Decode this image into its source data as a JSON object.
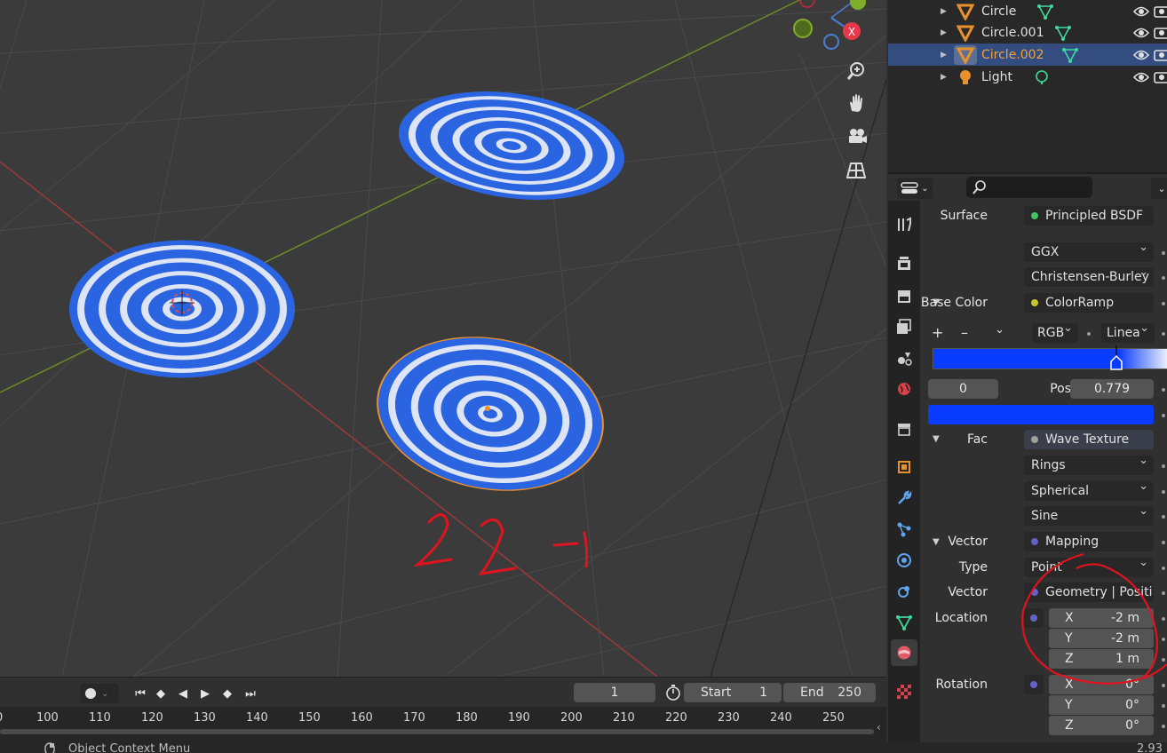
{
  "outliner": {
    "items": [
      {
        "name": "Circle",
        "type": "mesh"
      },
      {
        "name": "Circle.001",
        "type": "mesh"
      },
      {
        "name": "Circle.002",
        "type": "mesh",
        "selected": true
      },
      {
        "name": "Light",
        "type": "light"
      }
    ]
  },
  "properties": {
    "search_placeholder": "",
    "surface_label": "Surface",
    "surface_value": "Principled BSDF",
    "distribution": "GGX",
    "subsurface_method": "Christensen-Burley",
    "base_color_label": "Base Color",
    "base_color_value": "ColorRamp",
    "ramp_color_mode": "RGB",
    "ramp_interpolation": "Linea",
    "ramp_stop_index": "0",
    "pos_label": "Pos",
    "pos_value": "0.779",
    "fac_label": "Fac",
    "fac_value": "Wave Texture",
    "wave_type": "Rings",
    "wave_profile_dir": "Spherical",
    "wave_profile": "Sine",
    "vector_label": "Vector",
    "vector_value": "Mapping",
    "type_label": "Type",
    "type_value": "Point",
    "vector2_label": "Vector",
    "vector2_value": "Geometry | Positi...",
    "location_label": "Location",
    "location": {
      "x_label": "X",
      "x": "-2 m",
      "y_label": "Y",
      "y": "-2 m",
      "z_label": "Z",
      "z": "1 m"
    },
    "rotation_label": "Rotation",
    "rotation": {
      "x_label": "X",
      "x": "0°",
      "y_label": "Y",
      "y": "0°",
      "z_label": "Z",
      "z": "0°"
    }
  },
  "timeline": {
    "current_frame": "1",
    "start_label": "Start",
    "start": "1",
    "end_label": "End",
    "end": "250",
    "ruler": [
      "100",
      "110",
      "120",
      "130",
      "140",
      "150",
      "160",
      "170",
      "180",
      "190",
      "200",
      "210",
      "220",
      "230",
      "240",
      "250"
    ]
  },
  "statusbar": {
    "left": "Object Context Menu",
    "version": "2.93"
  },
  "annotation": {
    "text": "2 2 -1",
    "color": "#e0141e"
  },
  "colors": {
    "accent_selected": "#334d80",
    "ramp_blue": "#0a3cff",
    "wave_blue": "#2b64e0",
    "object_orange": "#e8902e",
    "mesh_green": "#3fd8a0"
  },
  "icons": {
    "vp_tools": [
      "zoom-icon",
      "hand-pan-icon",
      "camera-icon",
      "grid-view-icon"
    ],
    "prop_tabs": [
      "tool-icon",
      "render-icon",
      "output-icon",
      "view-layer-icon",
      "scene-icon",
      "world-icon",
      "collection-icon",
      "object-icon",
      "modifier-icon",
      "particles-icon",
      "physics-icon",
      "constraints-icon",
      "object-data-icon",
      "material-icon",
      "texture-icon"
    ]
  }
}
